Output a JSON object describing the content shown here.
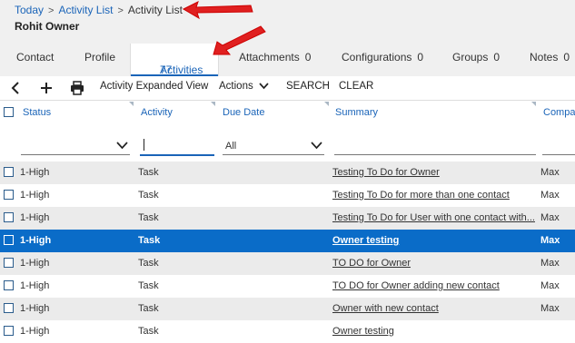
{
  "breadcrumb": [
    "Today",
    "Activity List",
    "Activity List"
  ],
  "owner": "Rohit Owner",
  "tabs": [
    {
      "label": "Contact",
      "count": ""
    },
    {
      "label": "Profile",
      "count": ""
    },
    {
      "label": "Activities",
      "count": "77"
    },
    {
      "label": "Attachments",
      "count": "0"
    },
    {
      "label": "Configurations",
      "count": "0"
    },
    {
      "label": "Groups",
      "count": "0"
    },
    {
      "label": "Notes",
      "count": "0"
    }
  ],
  "toolbar": {
    "expanded_view": "Activity Expanded View",
    "actions": "Actions",
    "search": "SEARCH",
    "clear": "CLEAR"
  },
  "columns": [
    "Status",
    "Activity",
    "Due Date",
    "Summary",
    "Compa"
  ],
  "filters": {
    "due_date": "All"
  },
  "rows": [
    {
      "status": "1-High",
      "activity": "Task",
      "summary": "Testing To Do for Owner",
      "company": "Max"
    },
    {
      "status": "1-High",
      "activity": "Task",
      "summary": "Testing To Do for more than one contact",
      "company": "Max"
    },
    {
      "status": "1-High",
      "activity": "Task",
      "summary": "Testing To Do for User with one contact with...",
      "company": "Max"
    },
    {
      "status": "1-High",
      "activity": "Task",
      "summary": "Owner testing",
      "company": "Max"
    },
    {
      "status": "1-High",
      "activity": "Task",
      "summary": "TO DO for Owner",
      "company": "Max"
    },
    {
      "status": "1-High",
      "activity": "Task",
      "summary": "TO DO for Owner adding new contact",
      "company": "Max"
    },
    {
      "status": "1-High",
      "activity": "Task",
      "summary": "Owner with new contact",
      "company": "Max"
    },
    {
      "status": "1-High",
      "activity": "Task",
      "summary": "Owner testing",
      "company": ""
    }
  ],
  "selected_row": 3,
  "colors": {
    "accent": "#1a64b8",
    "selected": "#0a6cc8",
    "annotation_arrow": "#e02020"
  }
}
